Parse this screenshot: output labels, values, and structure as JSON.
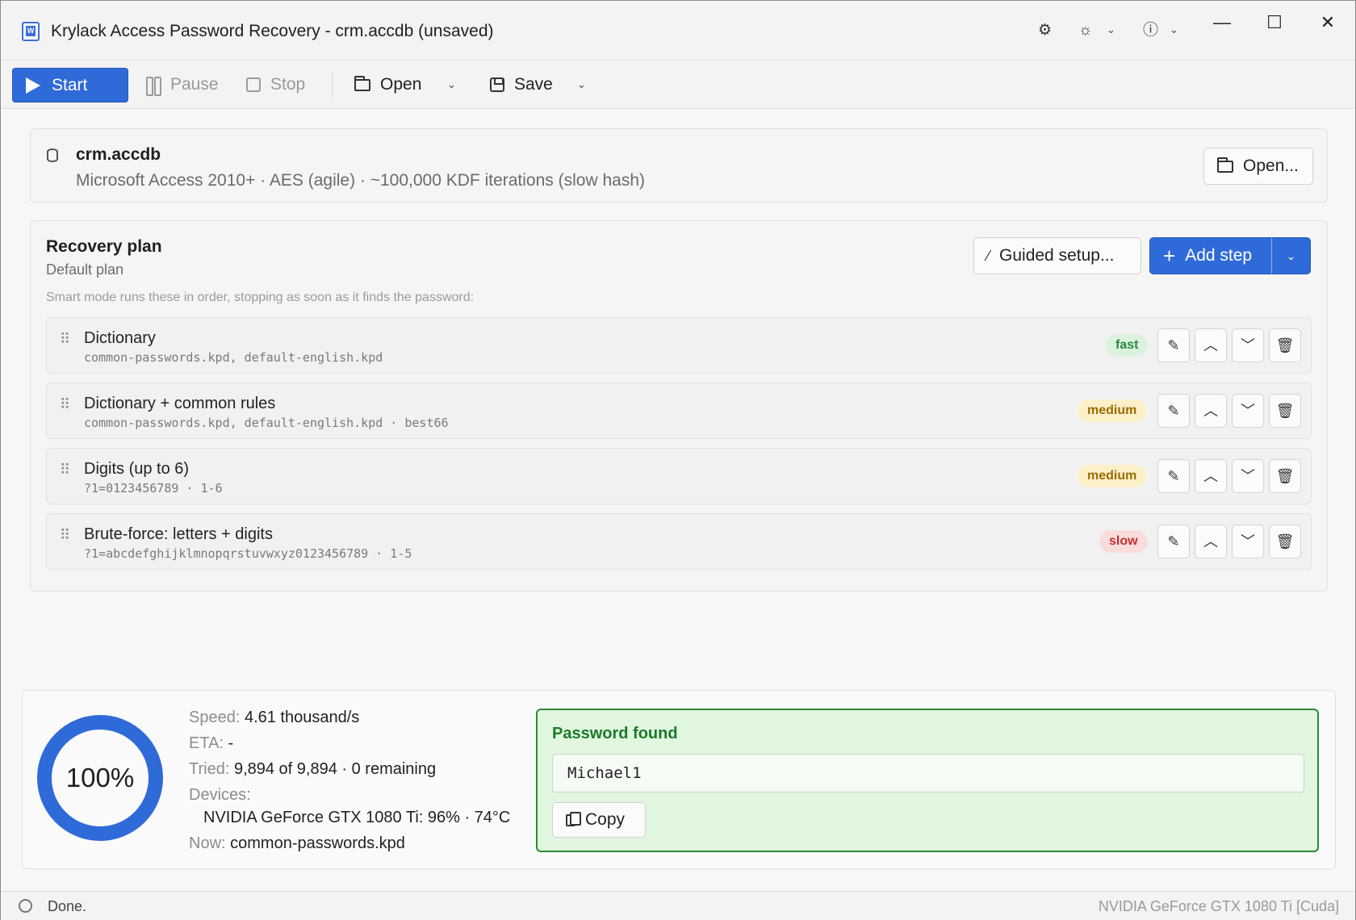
{
  "window": {
    "title": "Krylack Access Password Recovery - crm.accdb (unsaved)",
    "icons": [
      "app-icon",
      "gear-icon",
      "sun-icon",
      "help-icon"
    ],
    "controls": {
      "minimize": "—",
      "maximize": "☐",
      "close": "✕"
    }
  },
  "toolbar": {
    "start_label": "Start",
    "pause_label": "Pause",
    "stop_label": "Stop",
    "open_label": "Open",
    "save_label": "Save"
  },
  "file": {
    "name": "crm.accdb",
    "description": "Microsoft Access 2010+ · AES (agile) · ~100,000 KDF iterations (slow hash)",
    "open_button": "Open..."
  },
  "plan": {
    "title": "Recovery plan",
    "subtitle": "Default plan",
    "hint": "Smart mode runs these in order, stopping as soon as it finds the password:",
    "guided_button": "Guided setup...",
    "add_step_button": "Add step",
    "steps": [
      {
        "name": "Dictionary",
        "detail": "common-passwords.kpd, default-english.kpd",
        "speed": "fast"
      },
      {
        "name": "Dictionary + common rules",
        "detail": "common-passwords.kpd, default-english.kpd · best66",
        "speed": "medium"
      },
      {
        "name": "Digits (up to 6)",
        "detail": "?1=0123456789 · 1-6",
        "speed": "medium"
      },
      {
        "name": "Brute-force: letters + digits",
        "detail": "?1=abcdefghijklmnopqrstuvwxyz0123456789 · 1-5",
        "speed": "slow"
      }
    ]
  },
  "status": {
    "progress_label": "100%",
    "progress_fraction": 1.0,
    "speed_key": "Speed:",
    "speed_value": "4.61 thousand/s",
    "eta_key": "ETA:",
    "eta_value": "-",
    "tried_key": "Tried:",
    "tried_value": "9,894 of 9,894 · 0 remaining",
    "devices_key": "Devices:",
    "device_line": "NVIDIA GeForce GTX 1080 Ti: 96% · 74°C",
    "now_key": "Now:",
    "now_value": "common-passwords.kpd"
  },
  "result": {
    "title": "Password found",
    "password": "Michael1",
    "copy_button": "Copy"
  },
  "statusbar": {
    "text": "Done.",
    "device": "NVIDIA GeForce GTX 1080 Ti [Cuda]"
  },
  "colors": {
    "accent": "#2f6bd8",
    "success": "#2c8a34",
    "fast": "#2b8a3e",
    "medium": "#9a6b00",
    "slow": "#c23030"
  }
}
